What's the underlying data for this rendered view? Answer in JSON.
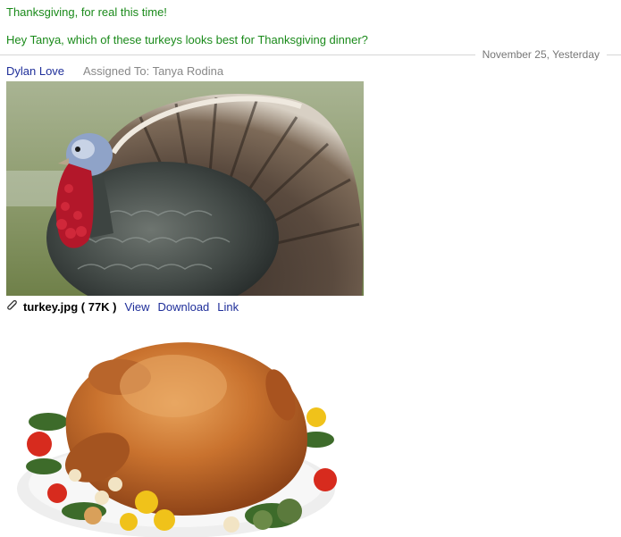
{
  "thread": {
    "subject": "Thanksgiving, for real this time!",
    "date": "November 25, Yesterday"
  },
  "message": {
    "text": "Hey Tanya, which of these turkeys looks best for Thanksgiving dinner?",
    "author": "Dylan Love",
    "assigned": "Assigned To: Tanya Rodina"
  },
  "attachment": {
    "icon": "paperclip-icon",
    "filename": "turkey.jpg ( 77K )",
    "view_label": "View",
    "download_label": "Download",
    "link_label": "Link"
  },
  "colors": {
    "subject": "#1a8a1a",
    "link": "#1f2f9a",
    "meta": "#888888"
  }
}
